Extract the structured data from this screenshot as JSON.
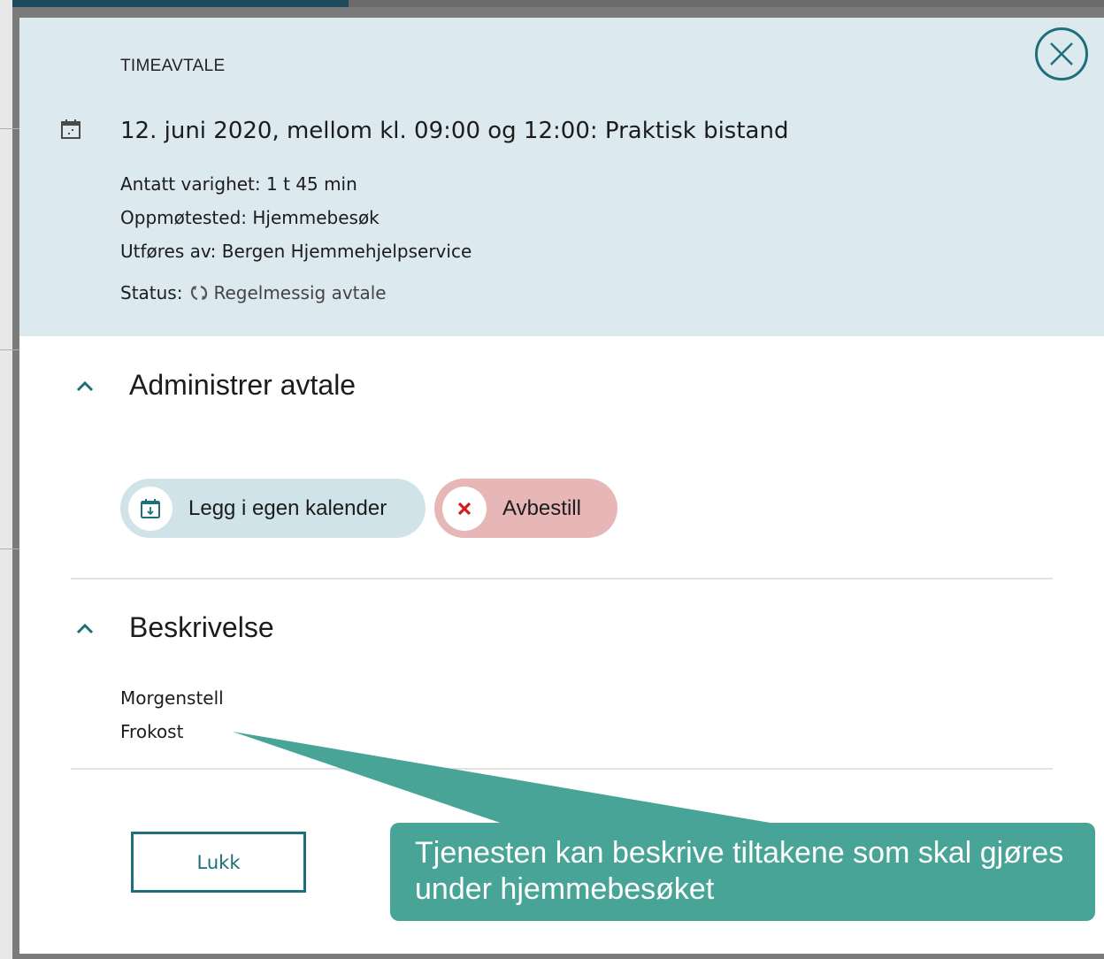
{
  "modal": {
    "header_label": "TIMEAVTALE",
    "title": "12. juni 2020, mellom kl. 09:00 og 12:00: Praktisk bistand",
    "details": [
      "Antatt varighet: 1 t 45 min",
      "Oppmøtested: Hjemmebesøk",
      "Utføres av: Bergen Hjemmehjelpservice"
    ],
    "status_label": "Status:",
    "status_value": "Regelmessig avtale"
  },
  "administrer": {
    "title": "Administrer avtale",
    "add_calendar_label": "Legg i egen kalender",
    "cancel_label": "Avbestill"
  },
  "beskrivelse": {
    "title": "Beskrivelse",
    "items": [
      "Morgenstell",
      "Frokost"
    ]
  },
  "footer": {
    "close_label": "Lukk"
  },
  "callout": {
    "text": "Tjenesten kan beskrive tiltakene som skal gjøres under hjemmebesøket"
  },
  "colors": {
    "accent": "#1f6f7a",
    "header_bg": "#dce9ee",
    "cancel_bg": "#e7b7b7",
    "calendar_bg": "#cfe3e9",
    "callout_bg": "#48a496"
  },
  "icons": {
    "close": "close-icon",
    "calendar": "calendar-icon",
    "status": "refresh-icon",
    "chevron": "chevron-up-icon",
    "calendar_download": "calendar-download-icon",
    "cancel": "x-icon"
  }
}
